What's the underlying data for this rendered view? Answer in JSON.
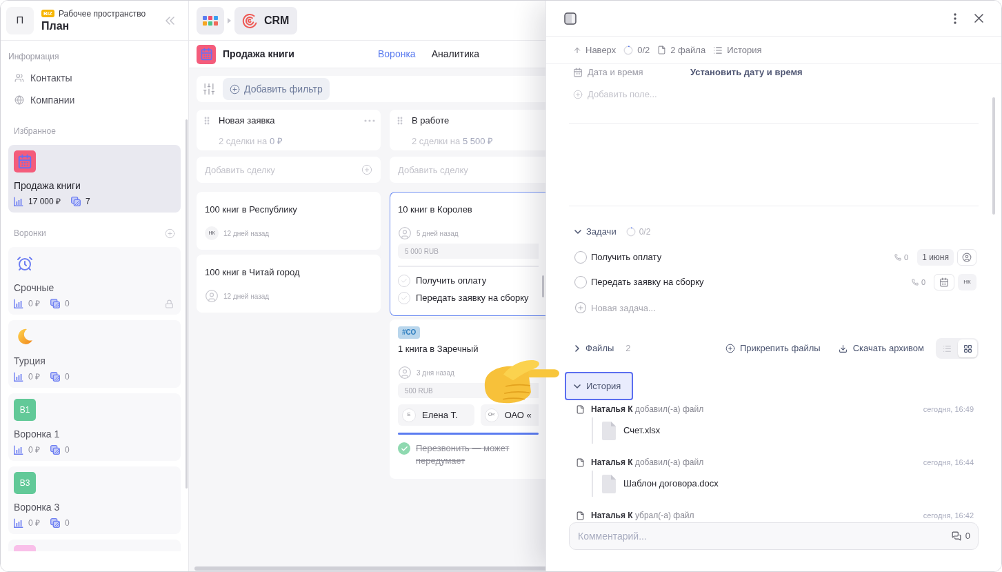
{
  "workspace": {
    "avatar": "П",
    "badge": "BIZ",
    "caption": "Рабочее пространство",
    "name": "План"
  },
  "sidebar": {
    "info_heading": "Информация",
    "info_items": [
      {
        "kind": "contacts",
        "label": "Контакты"
      },
      {
        "kind": "companies",
        "label": "Компании"
      }
    ],
    "favorites_heading": "Избранное",
    "favorites": [
      {
        "kind": "calendar",
        "name": "Продажа книги",
        "amount": "17 000 ₽",
        "deals": "7",
        "selected": true
      }
    ],
    "funnels_heading": "Воронки",
    "funnels": [
      {
        "kind": "alarm",
        "name": "Срочные",
        "amount": "0 ₽",
        "deals": "0",
        "locked": true,
        "selected": false
      },
      {
        "kind": "moon",
        "name": "Турция",
        "amount": "0 ₽",
        "deals": "0",
        "locked": false,
        "selected": false
      },
      {
        "kind": "letters",
        "letters": "В1",
        "color": "#62c998",
        "name": "Воронка 1",
        "amount": "0 ₽",
        "deals": "0",
        "locked": false,
        "selected": false
      },
      {
        "kind": "letters",
        "letters": "В3",
        "color": "#62c998",
        "name": "Воронка 3",
        "amount": "0 ₽",
        "deals": "0",
        "locked": false,
        "selected": false
      },
      {
        "kind": "letters",
        "color": "#f9bfe9",
        "selected": false
      }
    ]
  },
  "breadcrumb": {
    "app": "CRM"
  },
  "project": {
    "title": "Продажа книги",
    "tabs": [
      {
        "label": "Воронка",
        "selected": true
      },
      {
        "label": "Аналитика",
        "selected": false
      }
    ]
  },
  "filter": {
    "button": "Добавить фильтр"
  },
  "columns": [
    {
      "title": "Новая заявка",
      "deals_text": "2 сделки на",
      "total": "0 ₽",
      "actions_visible": true,
      "add_deal": {
        "placeholder": "Добавить сделку"
      },
      "cards": [
        {
          "title": "100 книг в Республику",
          "assignee": "НК",
          "age": "12 дней назад",
          "selected": false
        },
        {
          "title": "100 книг в Читай город",
          "age": "12 дней назад",
          "selected": false
        }
      ]
    },
    {
      "title": "В работе",
      "deals_text": "2 сделки на",
      "total": "5 500 ₽",
      "actions_visible": false,
      "add_deal": {
        "placeholder": "Добавить сделку"
      },
      "cards": [
        {
          "title": "10 книг в Королев",
          "age": "5 дней назад",
          "amount": "5 000 RUB",
          "tasks": [
            {
              "label": "Получить оплату",
              "done": false
            },
            {
              "label": "Передать заявку на сборку",
              "done": false
            }
          ],
          "selected": true
        },
        {
          "tag": "#СО",
          "title": "1 книга в Заречный",
          "age": "3 дня назад",
          "amount": "500 RUB",
          "contacts": [
            {
              "initials": "Е",
              "name": "Елена Т."
            },
            {
              "initials": "О«",
              "name": "ОАО «"
            }
          ],
          "level": 1,
          "tasks": [
            {
              "label": "Перезвонить — может передумает",
              "done": true
            }
          ],
          "selected": false
        }
      ]
    }
  ],
  "drawer": {
    "nav": [
      {
        "kind": "up",
        "label": "Наверх"
      },
      {
        "kind": "progress",
        "label": "0/2"
      },
      {
        "kind": "file",
        "label": "2 файла"
      },
      {
        "kind": "list",
        "label": "История"
      }
    ],
    "fields": [
      {
        "kind": "date",
        "label": "Дата и время",
        "value": "Установить дату и время"
      }
    ],
    "add_field": "Добавить поле...",
    "tasks": {
      "title": "Задачи",
      "progress": "0/2",
      "expanded": true,
      "items": [
        {
          "label": "Получить оплату",
          "done": false,
          "calls": "0",
          "date": "1 июня"
        },
        {
          "label": "Передать заявку на сборку",
          "done": false,
          "calls": "0",
          "assignee": "НК"
        }
      ],
      "new_task": {
        "placeholder": "Новая задача..."
      }
    },
    "files": {
      "title": "Файлы",
      "count": "2",
      "expanded": false,
      "attach": "Прикрепить файлы",
      "download": "Скачать архивом",
      "views": [
        {
          "kind": "list",
          "selected": false
        },
        {
          "kind": "grid",
          "selected": true
        }
      ]
    },
    "history": {
      "title": "История",
      "expanded": true,
      "focused": true,
      "entries": [
        {
          "author": "Наталья К",
          "action": "добавил(-а) файл",
          "time": "сегодня, 16:49",
          "file": "Счет.xlsx"
        },
        {
          "author": "Наталья К",
          "action": "добавил(-а) файл",
          "time": "сегодня, 16:44",
          "file": "Шаблон договора.docx"
        },
        {
          "author": "Наталья К",
          "action": "убрал(-а) файл",
          "time": "сегодня, 16:42"
        }
      ]
    },
    "comment": {
      "placeholder": "Комментарий...",
      "count": "0"
    }
  }
}
